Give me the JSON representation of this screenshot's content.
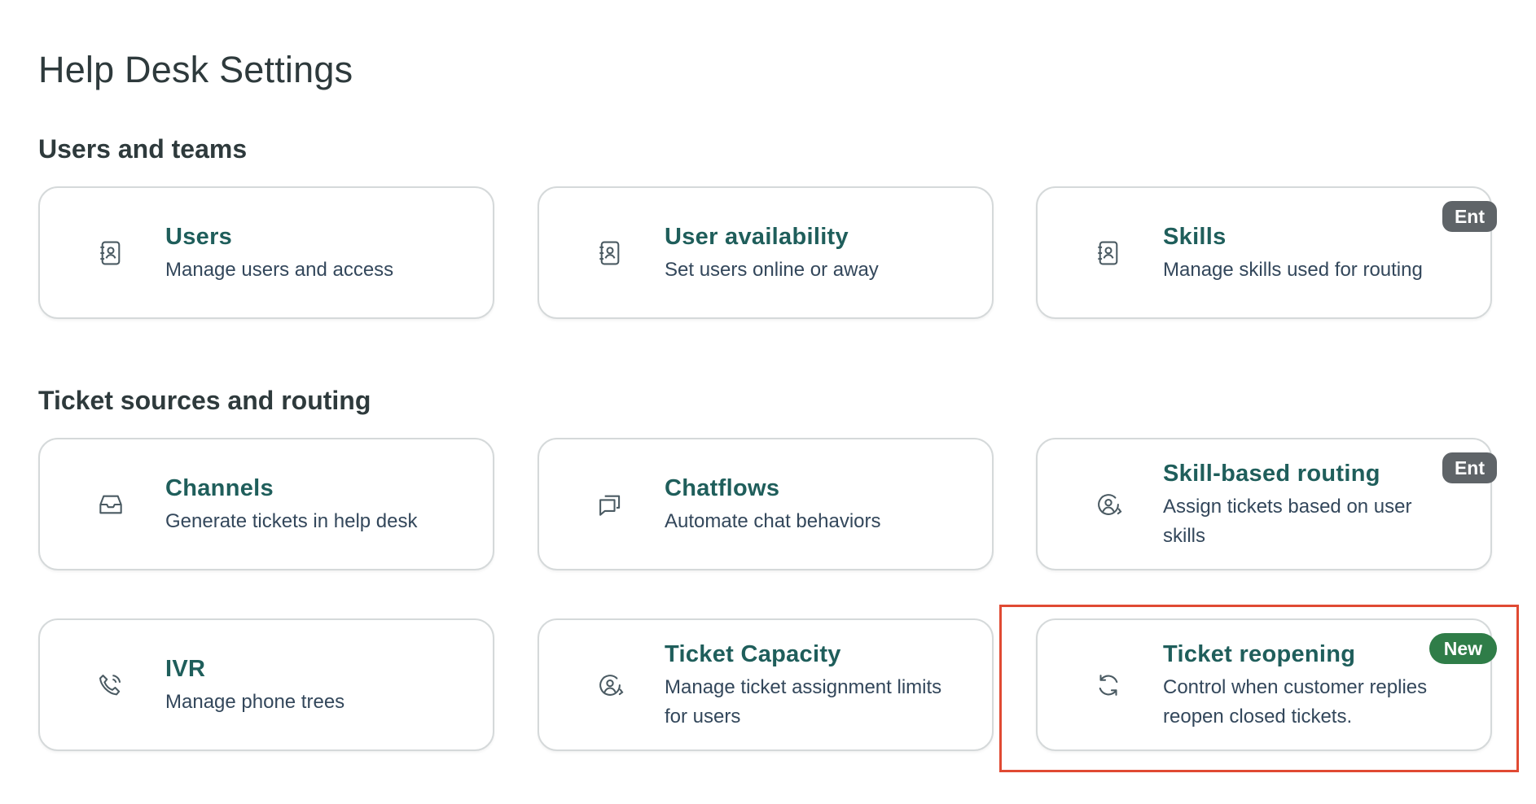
{
  "page": {
    "title": "Help Desk Settings"
  },
  "sections": [
    {
      "title": "Users and teams",
      "cards": [
        {
          "title": "Users",
          "desc": "Manage users and access",
          "icon": "contact-book-icon"
        },
        {
          "title": "User availability",
          "desc": "Set users online or away",
          "icon": "contact-book-icon"
        },
        {
          "title": "Skills",
          "desc": "Manage skills used for routing",
          "icon": "contact-book-icon",
          "badge": "Ent"
        }
      ]
    },
    {
      "title": "Ticket sources and routing",
      "cards": [
        {
          "title": "Channels",
          "desc": "Generate tickets in help desk",
          "icon": "inbox-icon"
        },
        {
          "title": "Chatflows",
          "desc": "Automate chat behaviors",
          "icon": "chat-bubbles-icon"
        },
        {
          "title": "Skill-based routing",
          "desc": "Assign tickets based on user skills",
          "icon": "user-routing-icon",
          "badge": "Ent"
        },
        {
          "title": "IVR",
          "desc": "Manage phone trees",
          "icon": "phone-icon"
        },
        {
          "title": "Ticket Capacity",
          "desc": "Manage ticket assignment limits for users",
          "icon": "user-routing-icon"
        },
        {
          "title": "Ticket reopening",
          "desc": "Control when customer replies reopen closed tickets.",
          "icon": "refresh-icon",
          "badge": "New"
        }
      ]
    }
  ],
  "colors": {
    "card_title": "#1f5e5b",
    "badge_ent": "#5f6468",
    "badge_new": "#2f7d48",
    "highlight": "#e04a33"
  }
}
